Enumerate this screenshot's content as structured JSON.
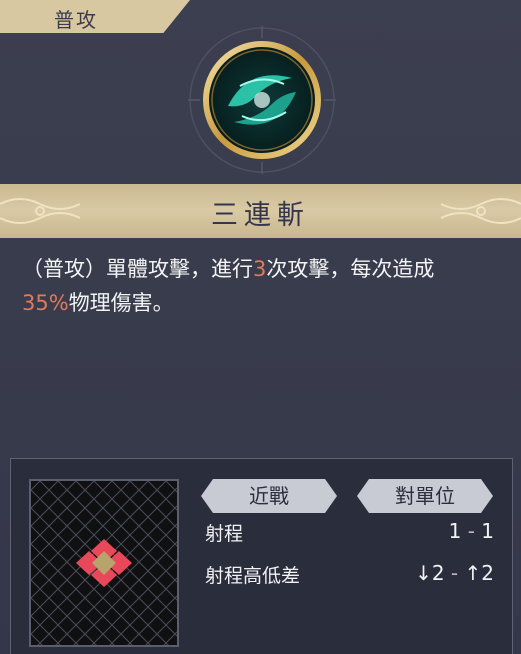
{
  "tab": {
    "label": "普攻"
  },
  "skill": {
    "icon": "green-swirl-slash-icon",
    "name": "三連斬",
    "description": {
      "part1": "（普攻）單體攻擊，進行",
      "hits": "3",
      "part2": "次攻擊，每次造成",
      "percent": "35%",
      "part3": "物理傷害。"
    }
  },
  "info": {
    "attack_type": "近戰",
    "target_type": "對單位",
    "range": {
      "label": "射程",
      "min": "1",
      "sep": "-",
      "max": "1"
    },
    "height_diff": {
      "label": "射程高低差",
      "down_arrow": "↓",
      "down": "2",
      "sep": "-",
      "up_arrow": "↑",
      "up": "2"
    }
  },
  "colors": {
    "accent_orange": "#e07a5a",
    "banner": "#d8c8a2",
    "target_cell": "#e8485a",
    "center_cell": "#b9a36c",
    "teal": "#2fd1b4"
  }
}
